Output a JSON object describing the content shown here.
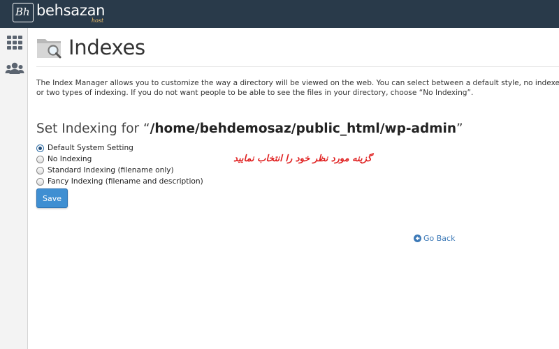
{
  "topbar": {
    "logo": {
      "mark": "Bh",
      "name": "behsazan",
      "sub": "host"
    },
    "colors": {
      "background": "#293a4a"
    }
  },
  "sidebar": {
    "items": [
      {
        "icon": "grid-apps-icon"
      },
      {
        "icon": "users-icon"
      }
    ]
  },
  "header": {
    "title": "Indexes",
    "icon": "folder-search-icon"
  },
  "description": "The Index Manager allows you to customize the way a directory will be viewed on the web. You can select between a default style, no indexes, or two types of indexing. If you do not want people to be able to see the files in your directory, choose “No Indexing”.",
  "set_indexing": {
    "label": "Set Indexing for ",
    "open_quote": "“",
    "path": "/home/behdemosaz/public_html/wp-admin",
    "close_quote": "”"
  },
  "options": [
    {
      "label": "Default System Setting",
      "checked": true
    },
    {
      "label": "No Indexing",
      "checked": false
    },
    {
      "label": "Standard Indexing (filename only)",
      "checked": false
    },
    {
      "label": "Fancy Indexing (filename and description)",
      "checked": false
    }
  ],
  "save_label": "Save",
  "annotation": "گزینه مورد نظر خود را انتخاب نمایید",
  "go_back": {
    "label": "Go Back",
    "icon": "arrow-left-circle-icon"
  },
  "colors": {
    "accent": "#3f8fd2",
    "link": "#3c79b7",
    "annotation": "#e02020"
  }
}
